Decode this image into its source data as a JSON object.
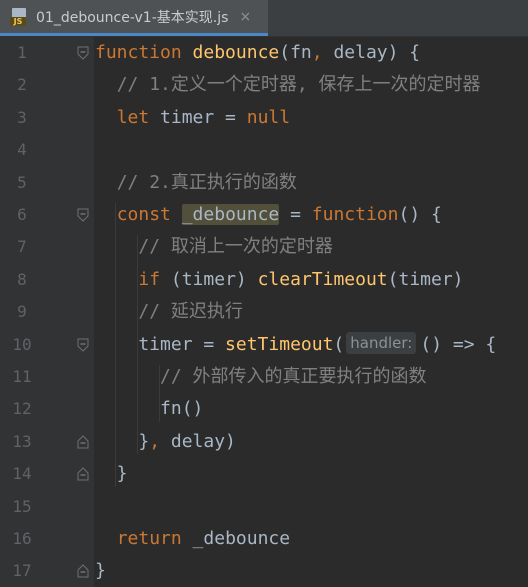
{
  "tab": {
    "icon_badge": "JS",
    "title": "01_debounce-v1-基本实现.js",
    "close_glyph": "×"
  },
  "editor": {
    "lines": [
      {
        "n": "1",
        "fold": "open-top",
        "tokens": [
          [
            "kw",
            "function"
          ],
          [
            "plain",
            " "
          ],
          [
            "fn",
            "debounce"
          ],
          [
            "plain",
            "(fn"
          ],
          [
            "kw",
            ","
          ],
          [
            "plain",
            " delay) {"
          ]
        ]
      },
      {
        "n": "2",
        "fold": "",
        "tokens": [
          [
            "plain",
            "  "
          ],
          [
            "cm",
            "// 1.定义一个定时器, 保存上一次的定时器"
          ]
        ]
      },
      {
        "n": "3",
        "fold": "",
        "tokens": [
          [
            "plain",
            "  "
          ],
          [
            "kw",
            "let"
          ],
          [
            "plain",
            " timer = "
          ],
          [
            "kw",
            "null"
          ]
        ]
      },
      {
        "n": "4",
        "fold": "",
        "tokens": []
      },
      {
        "n": "5",
        "fold": "",
        "tokens": [
          [
            "plain",
            "  "
          ],
          [
            "cm",
            "// 2.真正执行的函数"
          ]
        ]
      },
      {
        "n": "6",
        "fold": "open-top",
        "tokens": [
          [
            "plain",
            "  "
          ],
          [
            "kw",
            "const"
          ],
          [
            "plain",
            " "
          ],
          [
            "hl",
            "_debounce"
          ],
          [
            "plain",
            " = "
          ],
          [
            "kw",
            "function"
          ],
          [
            "plain",
            "() {"
          ]
        ]
      },
      {
        "n": "7",
        "fold": "",
        "tokens": [
          [
            "plain",
            "    "
          ],
          [
            "cm",
            "// 取消上一次的定时器"
          ]
        ]
      },
      {
        "n": "8",
        "fold": "",
        "tokens": [
          [
            "plain",
            "    "
          ],
          [
            "kw",
            "if"
          ],
          [
            "plain",
            " (timer) "
          ],
          [
            "fn",
            "clearTimeout"
          ],
          [
            "plain",
            "(timer)"
          ]
        ]
      },
      {
        "n": "9",
        "fold": "",
        "tokens": [
          [
            "plain",
            "    "
          ],
          [
            "cm",
            "// 延迟执行"
          ]
        ]
      },
      {
        "n": "10",
        "fold": "open-top",
        "tokens": [
          [
            "plain",
            "    timer = "
          ],
          [
            "fn",
            "setTimeout"
          ],
          [
            "plain",
            "("
          ],
          [
            "hint",
            "handler:"
          ],
          [
            "plain",
            "() => {"
          ]
        ]
      },
      {
        "n": "11",
        "fold": "",
        "tokens": [
          [
            "plain",
            "      "
          ],
          [
            "cm",
            "// 外部传入的真正要执行的函数"
          ]
        ]
      },
      {
        "n": "12",
        "fold": "",
        "tokens": [
          [
            "plain",
            "      fn()"
          ]
        ]
      },
      {
        "n": "13",
        "fold": "close-bottom",
        "tokens": [
          [
            "plain",
            "    }"
          ],
          [
            "kw",
            ","
          ],
          [
            "plain",
            " delay)"
          ]
        ]
      },
      {
        "n": "14",
        "fold": "close-bottom",
        "tokens": [
          [
            "plain",
            "  }"
          ]
        ]
      },
      {
        "n": "15",
        "fold": "",
        "tokens": []
      },
      {
        "n": "16",
        "fold": "",
        "tokens": [
          [
            "plain",
            "  "
          ],
          [
            "kw",
            "return"
          ],
          [
            "plain",
            " _debounce"
          ]
        ]
      },
      {
        "n": "17",
        "fold": "close-bottom",
        "tokens": [
          [
            "plain",
            "}"
          ]
        ]
      }
    ]
  },
  "colors": {
    "background": "#2b2b2b",
    "gutter": "#313335",
    "keyword": "#cc7832",
    "function": "#ffc66d",
    "comment": "#808080",
    "text": "#a9b7c6",
    "line_number": "#606366",
    "tab_underline": "#4a88c7"
  },
  "icons": {
    "file": "javascript-file-icon",
    "close": "close-icon",
    "fold_open": "fold-open-icon",
    "fold_close": "fold-close-icon"
  }
}
